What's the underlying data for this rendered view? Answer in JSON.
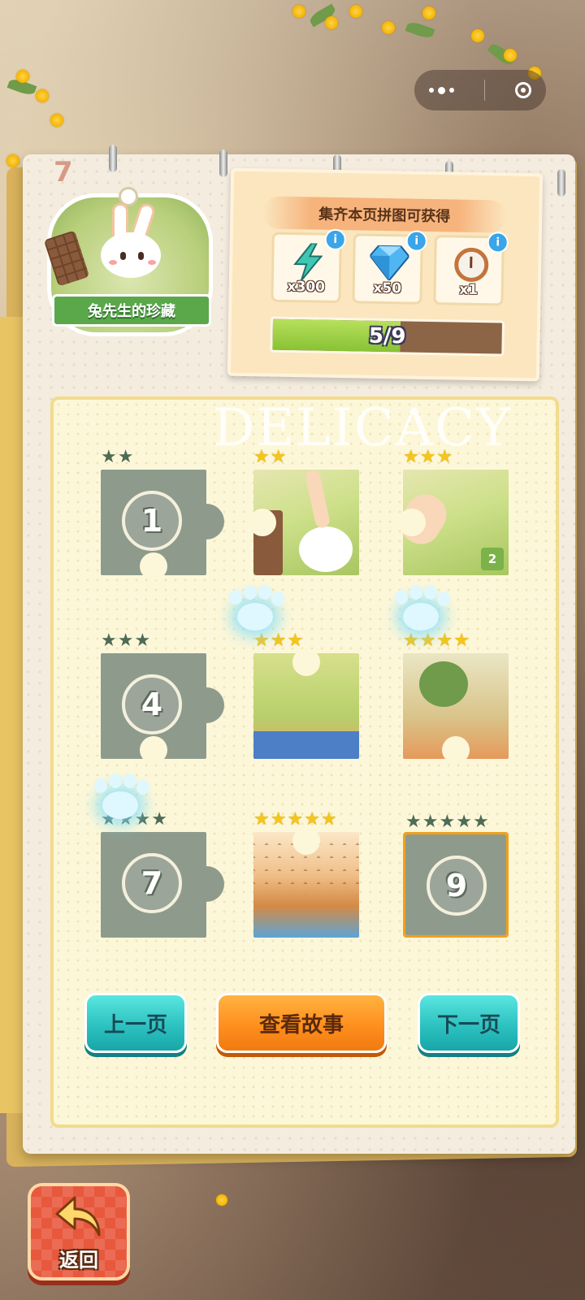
{
  "album": {
    "page_number": "7",
    "title": "兔先生的珍藏",
    "watermark": "DELICACY"
  },
  "reward": {
    "title": "集齐本页拼图可获得",
    "items": [
      {
        "icon": "lightning-icon",
        "count": "x300"
      },
      {
        "icon": "diamond-icon",
        "count": "x50"
      },
      {
        "icon": "alarm-clock-icon",
        "count": "x1"
      }
    ],
    "info_glyph": "i",
    "progress_text": "5/9",
    "progress_value": 0.556
  },
  "pieces": [
    {
      "id": 1,
      "label": "1",
      "state": "locked",
      "stars_on": 0,
      "stars_total": 2
    },
    {
      "id": 2,
      "label": "",
      "state": "collected",
      "stars_on": 2,
      "stars_total": 2
    },
    {
      "id": 3,
      "label": "",
      "state": "collected",
      "stars_on": 3,
      "stars_total": 3,
      "duplicate_badge": "2"
    },
    {
      "id": 4,
      "label": "4",
      "state": "locked",
      "stars_on": 0,
      "stars_total": 3
    },
    {
      "id": 5,
      "label": "",
      "state": "collected",
      "stars_on": 3,
      "stars_total": 3
    },
    {
      "id": 6,
      "label": "",
      "state": "collected",
      "stars_on": 4,
      "stars_total": 4
    },
    {
      "id": 7,
      "label": "7",
      "state": "locked",
      "stars_on": 0,
      "stars_total": 4
    },
    {
      "id": 8,
      "label": "",
      "state": "collected",
      "stars_on": 5,
      "stars_total": 5
    },
    {
      "id": 9,
      "label": "9",
      "state": "locked",
      "stars_on": 0,
      "stars_total": 5
    }
  ],
  "buttons": {
    "prev": "上一页",
    "story": "查看故事",
    "next": "下一页",
    "back": "返回"
  },
  "colors": {
    "teal_button": "#2cc2c0",
    "orange_button": "#ff8f1e",
    "locked_piece": "#8e9b8c",
    "star_on": "#f5c518",
    "progress_fill": "#88c234"
  }
}
